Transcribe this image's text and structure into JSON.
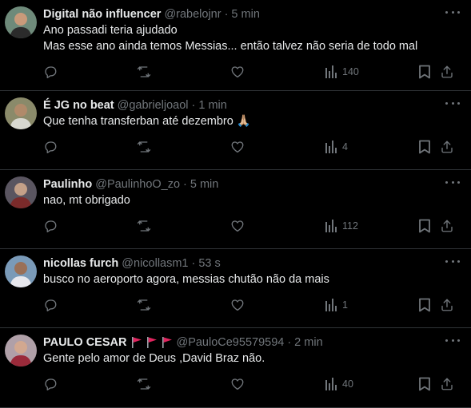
{
  "tweets": [
    {
      "name": "Digital não influencer",
      "handle": "@rabelojnr",
      "time": "5 min",
      "lines": [
        "Ano passadi teria ajudado",
        "Mas esse ano ainda temos Messias... então talvez não seria de todo mal"
      ],
      "views": "140",
      "avatar_colors": {
        "bg": "#6e8a7a",
        "skin": "#c99a7a",
        "shirt": "#2b2b2b"
      }
    },
    {
      "name": "É JG no beat",
      "handle": "@gabrieljoaol",
      "time": "1 min",
      "lines": [
        "Que tenha transferban até dezembro 🙏🏼"
      ],
      "views": "4",
      "avatar_colors": {
        "bg": "#8a8a6a",
        "skin": "#b08a6a",
        "shirt": "#d8d8d0"
      }
    },
    {
      "name": "Paulinho",
      "handle": "@PaulinhoO_zo",
      "time": "5 min",
      "lines": [
        "nao, mt obrigado"
      ],
      "views": "112",
      "avatar_colors": {
        "bg": "#5a5560",
        "skin": "#c4a088",
        "shirt": "#7a2a2a"
      }
    },
    {
      "name": "nicollas furch",
      "handle": "@nicollasm1",
      "time": "53 s",
      "lines": [
        "busco no aeroporto agora, messias chutão não da mais"
      ],
      "views": "1",
      "avatar_colors": {
        "bg": "#7a9ab8",
        "skin": "#9a7058",
        "shirt": "#e8e8ee"
      }
    },
    {
      "name": "PAULO CESAR",
      "handle": "@PauloCe95579594",
      "time": "2 min",
      "flags": [
        "red-flag-icon",
        "red-flag-icon",
        "red-flag-icon"
      ],
      "lines": [
        "Gente pelo amor de Deus ,David Braz não."
      ],
      "views": "40",
      "avatar_colors": {
        "bg": "#b0a0a8",
        "skin": "#d2a890",
        "shirt": "#9a2a3a"
      }
    }
  ],
  "colors": {
    "background": "#000000",
    "text": "#e7e9ea",
    "muted": "#71767b",
    "border": "#2f3336",
    "flag": "#e0245e"
  }
}
